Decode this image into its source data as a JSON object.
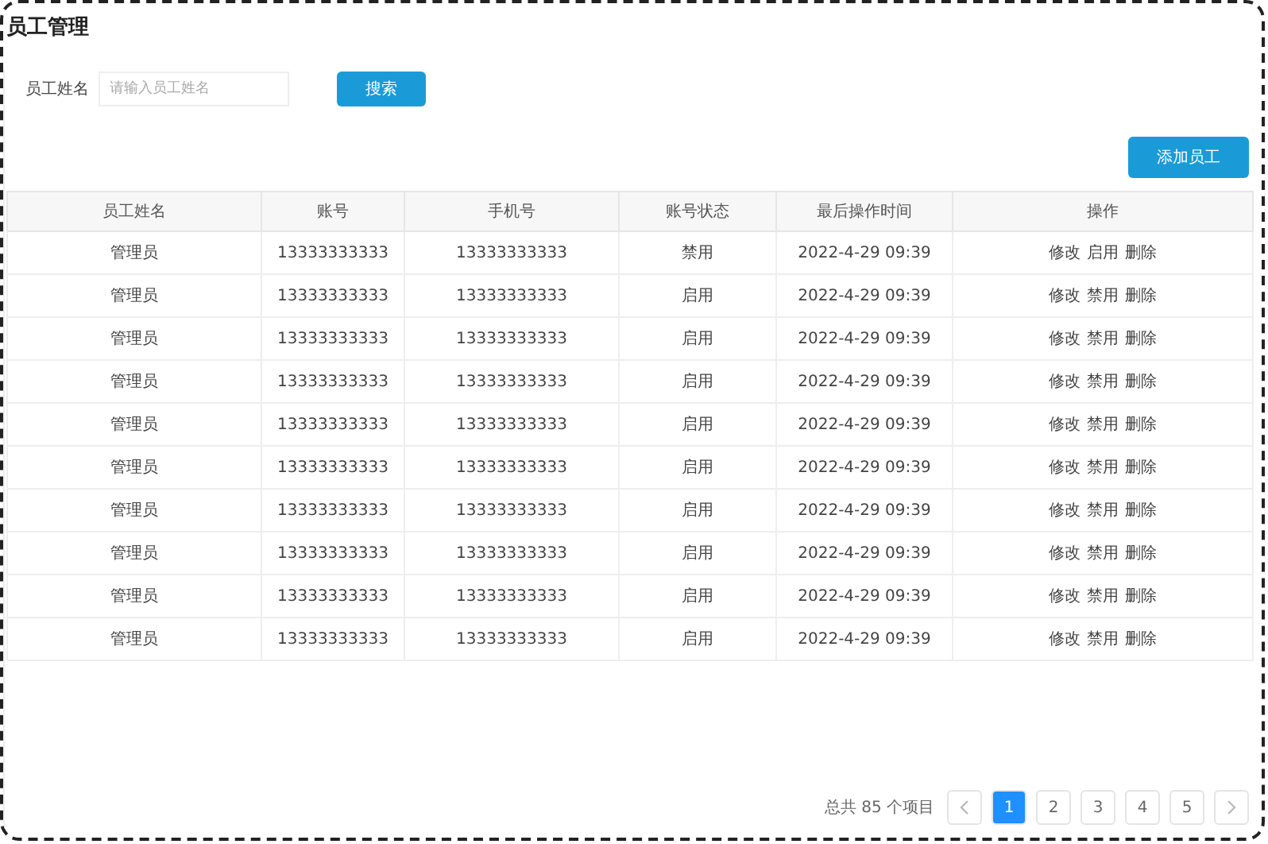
{
  "title": "员工管理",
  "search": {
    "label": "员工姓名",
    "placeholder": "请输入员工姓名",
    "button": "搜索"
  },
  "add_button": "添加员工",
  "table": {
    "columns": [
      "员工姓名",
      "账号",
      "手机号",
      "账号状态",
      "最后操作时间",
      "操作"
    ],
    "rows": [
      {
        "name": "管理员",
        "account": "13333333333",
        "phone": "13333333333",
        "status": "禁用",
        "time": "2022-4-29 09:39",
        "actions": [
          "修改",
          "启用",
          "删除"
        ]
      },
      {
        "name": "管理员",
        "account": "13333333333",
        "phone": "13333333333",
        "status": "启用",
        "time": "2022-4-29 09:39",
        "actions": [
          "修改",
          "禁用",
          "删除"
        ]
      },
      {
        "name": "管理员",
        "account": "13333333333",
        "phone": "13333333333",
        "status": "启用",
        "time": "2022-4-29 09:39",
        "actions": [
          "修改",
          "禁用",
          "删除"
        ]
      },
      {
        "name": "管理员",
        "account": "13333333333",
        "phone": "13333333333",
        "status": "启用",
        "time": "2022-4-29 09:39",
        "actions": [
          "修改",
          "禁用",
          "删除"
        ]
      },
      {
        "name": "管理员",
        "account": "13333333333",
        "phone": "13333333333",
        "status": "启用",
        "time": "2022-4-29 09:39",
        "actions": [
          "修改",
          "禁用",
          "删除"
        ]
      },
      {
        "name": "管理员",
        "account": "13333333333",
        "phone": "13333333333",
        "status": "启用",
        "time": "2022-4-29 09:39",
        "actions": [
          "修改",
          "禁用",
          "删除"
        ]
      },
      {
        "name": "管理员",
        "account": "13333333333",
        "phone": "13333333333",
        "status": "启用",
        "time": "2022-4-29 09:39",
        "actions": [
          "修改",
          "禁用",
          "删除"
        ]
      },
      {
        "name": "管理员",
        "account": "13333333333",
        "phone": "13333333333",
        "status": "启用",
        "time": "2022-4-29 09:39",
        "actions": [
          "修改",
          "禁用",
          "删除"
        ]
      },
      {
        "name": "管理员",
        "account": "13333333333",
        "phone": "13333333333",
        "status": "启用",
        "time": "2022-4-29 09:39",
        "actions": [
          "修改",
          "禁用",
          "删除"
        ]
      },
      {
        "name": "管理员",
        "account": "13333333333",
        "phone": "13333333333",
        "status": "启用",
        "time": "2022-4-29 09:39",
        "actions": [
          "修改",
          "禁用",
          "删除"
        ]
      }
    ]
  },
  "pagination": {
    "total": "总共 85 个项目",
    "pages": [
      {
        "label": "1",
        "selected": true
      },
      {
        "label": "2",
        "selected": false
      },
      {
        "label": "3",
        "selected": false
      },
      {
        "label": "4",
        "selected": false
      },
      {
        "label": "5",
        "selected": false
      }
    ]
  }
}
